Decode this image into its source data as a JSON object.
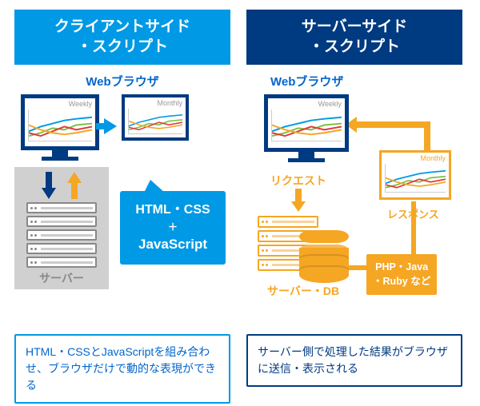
{
  "left": {
    "header": "クライアントサイド\n・スクリプト",
    "browser_label": "Webブラウザ",
    "chart1_label": "Weekly",
    "chart2_label": "Monthly",
    "server_label": "サーバー",
    "callout_line1": "HTML・CSS",
    "callout_plus": "＋",
    "callout_js": "JavaScript",
    "desc": "HTML・CSSとJavaScriptを組み合わせ、ブラウザだけで動的な表現ができる"
  },
  "right": {
    "header": "サーバーサイド\n・スクリプト",
    "browser_label": "Webブラウザ",
    "chart1_label": "Weekly",
    "chart2_label": "Monthly",
    "request_label": "リクエスト",
    "response_label": "レスポンス",
    "serverdb_label": "サーバー・DB",
    "langs": "PHP・Java\n・Ruby など",
    "desc": "サーバー側で処理した結果がブラウザに送信・表示される"
  }
}
